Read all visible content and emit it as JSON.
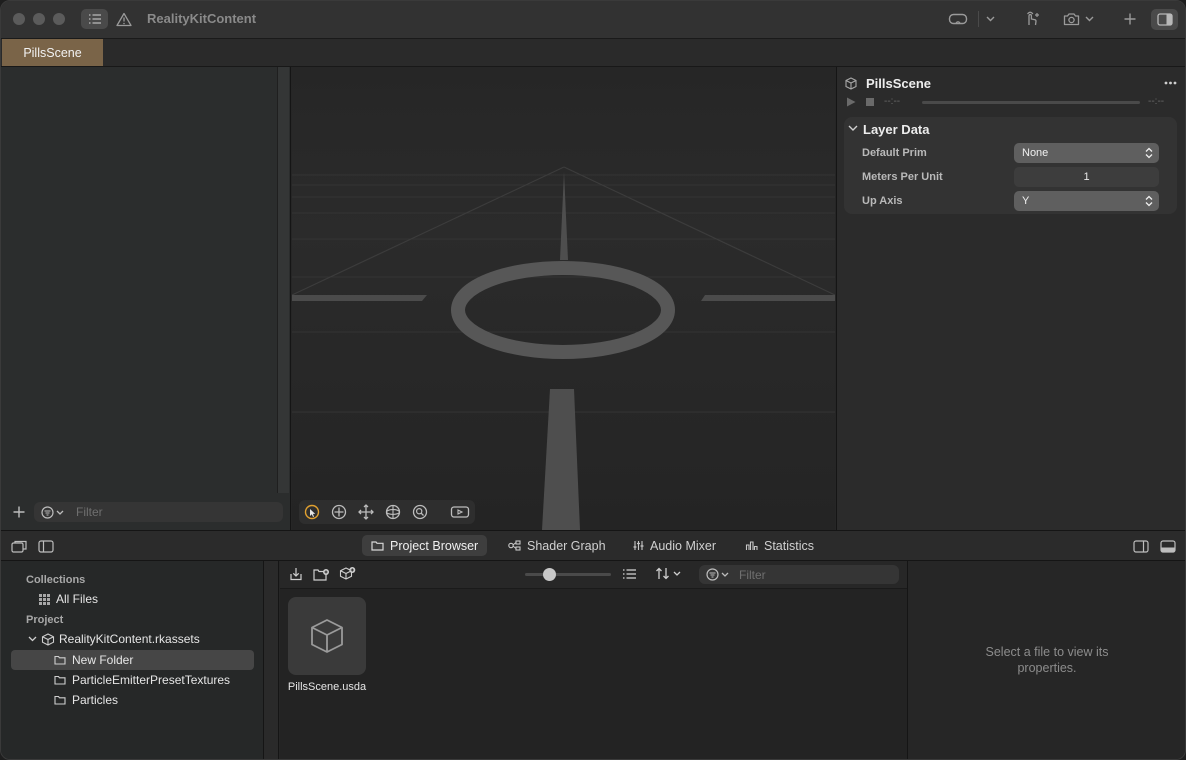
{
  "window": {
    "title": "RealityKitContent"
  },
  "tabs": [
    {
      "label": "PillsScene"
    }
  ],
  "left_panel": {
    "filter_placeholder": "Filter"
  },
  "inspector": {
    "title": "PillsScene",
    "time_start": "--:--",
    "time_end": "--:--",
    "section_title": "Layer Data",
    "properties": [
      {
        "label": "Default Prim",
        "value": "None",
        "kind": "popup"
      },
      {
        "label": "Meters Per Unit",
        "value": "1",
        "kind": "number"
      },
      {
        "label": "Up Axis",
        "value": "Y",
        "kind": "popup"
      }
    ]
  },
  "bottom_tabs": [
    {
      "label": "Project Browser",
      "icon": "folder-icon"
    },
    {
      "label": "Shader Graph",
      "icon": "node-graph-icon"
    },
    {
      "label": "Audio Mixer",
      "icon": "sliders-icon"
    },
    {
      "label": "Statistics",
      "icon": "bar-chart-icon"
    }
  ],
  "sidebar": {
    "collections_header": "Collections",
    "all_files": "All Files",
    "project_header": "Project",
    "root": "RealityKitContent.rkassets",
    "items": [
      {
        "label": "New Folder"
      },
      {
        "label": "ParticleEmitterPresetTextures"
      },
      {
        "label": "Particles"
      }
    ]
  },
  "browser": {
    "filter_placeholder": "Filter",
    "zoom_level": 0.25,
    "files": [
      {
        "name": "PillsScene.usda"
      }
    ]
  },
  "properties_panel": {
    "message": "Select a file to view its properties."
  },
  "colors": {
    "tab_accent": "#7a6448",
    "active_tool": "#e0a030"
  }
}
